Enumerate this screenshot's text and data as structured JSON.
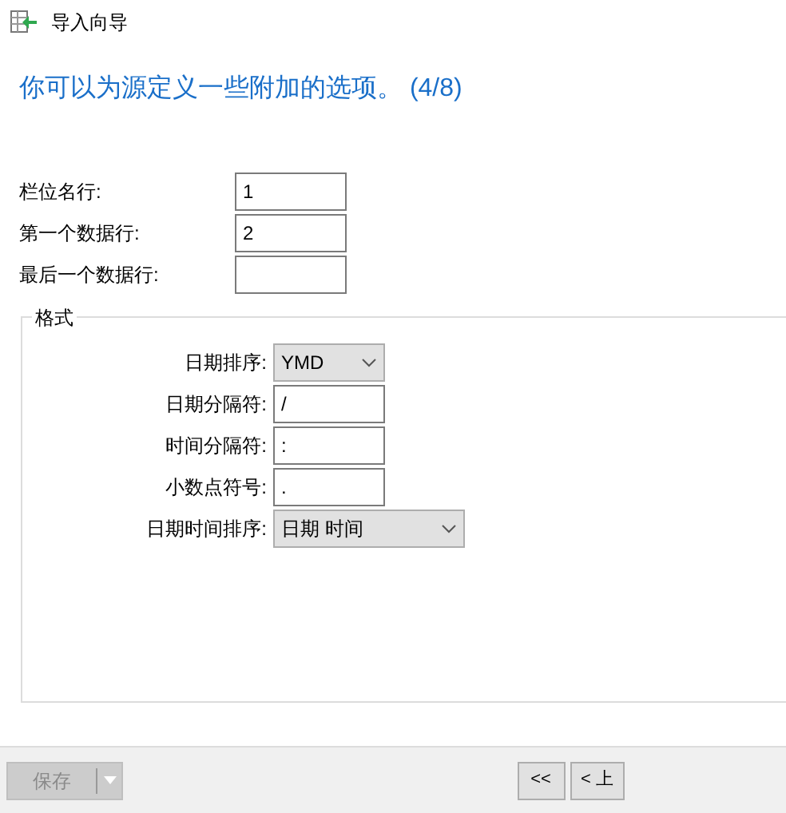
{
  "window": {
    "title": "导入向导"
  },
  "heading": "你可以为源定义一些附加的选项。 (4/8)",
  "rows": [
    {
      "label": "栏位名行:",
      "value": "1"
    },
    {
      "label": "第一个数据行:",
      "value": "2"
    },
    {
      "label": "最后一个数据行:",
      "value": ""
    }
  ],
  "format": {
    "title": "格式",
    "fields": [
      {
        "kind": "select",
        "label": "日期排序:",
        "value": "YMD"
      },
      {
        "kind": "text",
        "label": "日期分隔符:",
        "value": "/"
      },
      {
        "kind": "text",
        "label": "时间分隔符:",
        "value": ":"
      },
      {
        "kind": "text",
        "label": "小数点符号:",
        "value": "."
      },
      {
        "kind": "select",
        "label": "日期时间排序:",
        "value": "日期 时间"
      }
    ]
  },
  "footer": {
    "save": {
      "label": "保存",
      "disabled": true
    },
    "nav": [
      "<<",
      "< 上"
    ]
  }
}
